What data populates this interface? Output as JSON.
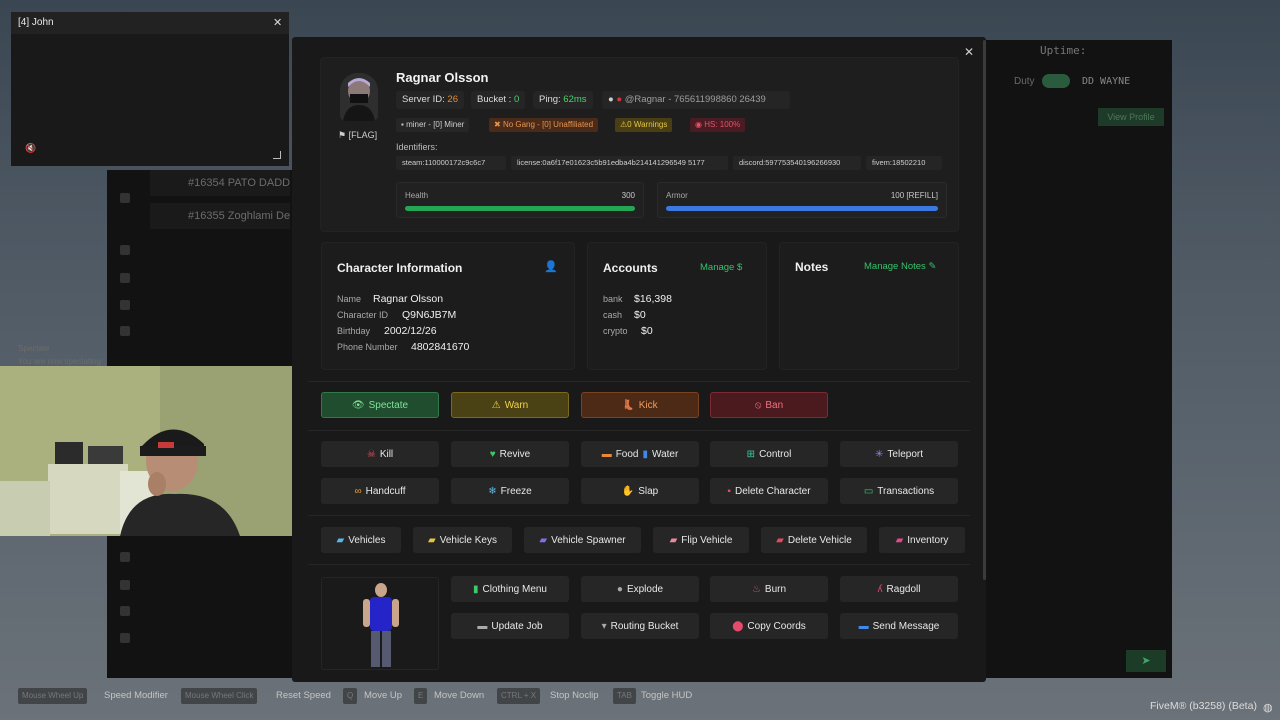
{
  "video_window": {
    "title": "[4] John",
    "close_glyph": "✕",
    "mute_icon": "speaker-muted-icon"
  },
  "background": {
    "rows": [
      "#16354 PATO DADDY",
      "#16355 Zoghlami Dekk"
    ],
    "uptime": "Uptime:",
    "duty": "Duty",
    "player": "DD WAYNE",
    "view_profile": "View Profile",
    "spectate_title": "Spectate",
    "spectate_msg": "You are now spectating"
  },
  "modal": {
    "close_glyph": "✕",
    "player": {
      "name": "Ragnar Olsson",
      "flag_label": "[FLAG]",
      "server_id_label": "Server ID:",
      "server_id": "26",
      "bucket_label": "Bucket :",
      "bucket": "0",
      "ping_label": "Ping:",
      "ping": "62ms",
      "discord_handle": "@Ragnar - 765611998860 26439",
      "badges": {
        "job": "miner - [0] Miner",
        "gang": "No Gang - [0] Unaffiliated",
        "warnings": "0 Warnings",
        "hs": "HS: 100%"
      },
      "identifiers_label": "Identifiers:",
      "identifiers": [
        "steam:110000172c9c6c7",
        "license:0a6f17e01623c5b91edba4b214141296549 5177",
        "discord:597753540196266930",
        "fivem:18502210"
      ],
      "health_label": "Health",
      "health_value": "300",
      "health_fraction": 1.0,
      "armor_label": "Armor",
      "armor_value": "100 [REFILL]",
      "armor_fraction": 1.0
    },
    "character": {
      "title": "Character Information",
      "name_label": "Name",
      "name": "Ragnar Olsson",
      "cid_label": "Character ID",
      "cid": "Q9N6JB7M",
      "birthday_label": "Birthday",
      "birthday": "2002/12/26",
      "phone_label": "Phone Number",
      "phone": "4802841670"
    },
    "accounts": {
      "title": "Accounts",
      "manage": "Manage",
      "bank_label": "bank",
      "bank": "$16,398",
      "cash_label": "cash",
      "cash": "$0",
      "crypto_label": "crypto",
      "crypto": "$0"
    },
    "notes": {
      "title": "Notes",
      "manage": "Manage Notes"
    },
    "actions_primary": [
      "Spectate",
      "Warn",
      "Kick",
      "Ban"
    ],
    "actions_row1": [
      "Kill",
      "Revive",
      "Food",
      "Water",
      "Control",
      "Teleport"
    ],
    "actions_row2": [
      "Handcuff",
      "Freeze",
      "Slap",
      "Delete Character",
      "Transactions"
    ],
    "vehicle_actions": [
      "Vehicles",
      "Vehicle Keys",
      "Vehicle Spawner",
      "Flip Vehicle",
      "Delete Vehicle",
      "Inventory"
    ],
    "misc_row1": [
      "Clothing Menu",
      "Explode",
      "Burn",
      "Ragdoll"
    ],
    "misc_row2": [
      "Update Job",
      "Routing Bucket",
      "Copy Coords",
      "Send Message"
    ]
  },
  "hints": {
    "keys": [
      "Mouse Wheel Up",
      "Mouse Wheel Click",
      "Q",
      "E",
      "CTRL + X",
      "TAB"
    ],
    "labels": [
      "Speed Modifier",
      "Reset Speed",
      "Move Up",
      "Move Down",
      "Stop Noclip",
      "Toggle HUD"
    ]
  },
  "fivem_version": "FiveM® (b3258) (Beta)",
  "colors": {
    "green": "#35c26a",
    "health": "#24a654",
    "armor": "#3b78e0",
    "spectate_bg": "#1f4d2e",
    "warn_bg": "#4a4114",
    "kick_bg": "#4d2a15",
    "ban_bg": "#4b1a1f"
  }
}
